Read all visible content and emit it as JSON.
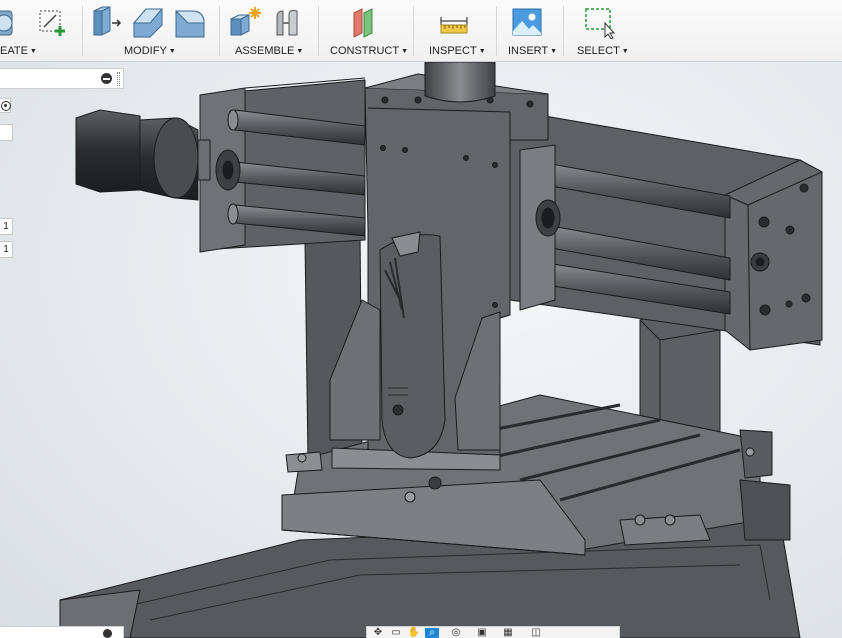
{
  "toolbar": {
    "groups": [
      {
        "name": "create",
        "label": "EATE"
      },
      {
        "name": "modify",
        "label": "MODIFY"
      },
      {
        "name": "assemble",
        "label": "ASSEMBLE"
      },
      {
        "name": "construct",
        "label": "CONSTRUCT"
      },
      {
        "name": "inspect",
        "label": "INSPECT"
      },
      {
        "name": "insert",
        "label": "INSERT"
      },
      {
        "name": "select",
        "label": "SELECT"
      }
    ],
    "dropdown_caret": "▼"
  },
  "browser": {
    "row_values": [
      "1",
      "1"
    ]
  },
  "colors": {
    "accent": "#1f88d6",
    "metal_dark": "#4a4c4f",
    "metal_mid": "#6d7074",
    "metal_light": "#9a9da1",
    "background": "#e4e8ec"
  },
  "icons": [
    "sketch-create-icon",
    "press-pull-icon",
    "fillet-icon",
    "chamfer-icon",
    "new-component-icon",
    "joint-icon",
    "offset-plane-icon",
    "measure-icon",
    "insert-image-icon",
    "select-window-icon",
    "orbit-icon",
    "pan-icon",
    "zoom-icon",
    "display-settings-icon",
    "grid-settings-icon",
    "viewports-icon"
  ]
}
